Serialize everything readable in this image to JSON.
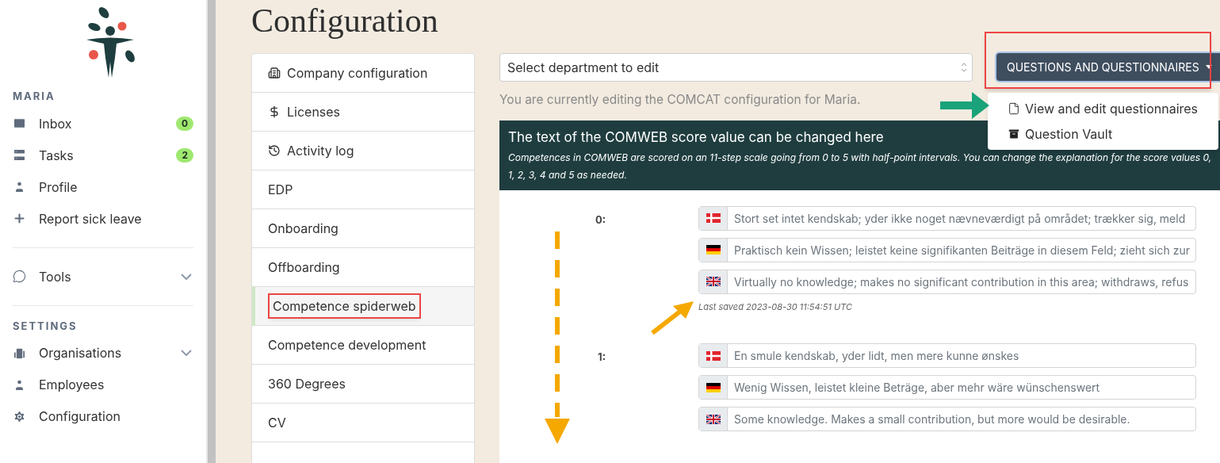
{
  "sidebar": {
    "sections": [
      {
        "heading": "MARIA",
        "items": [
          {
            "label": "Inbox",
            "badge": "0"
          },
          {
            "label": "Tasks",
            "badge": "2"
          },
          {
            "label": "Profile"
          },
          {
            "label": "Report sick leave"
          }
        ]
      },
      {
        "items": [
          {
            "label": "Tools",
            "expandable": true
          }
        ]
      },
      {
        "heading": "SETTINGS",
        "items": [
          {
            "label": "Organisations",
            "expandable": true
          },
          {
            "label": "Employees"
          },
          {
            "label": "Configuration"
          }
        ]
      }
    ]
  },
  "page_title": "Configuration",
  "config_menu": [
    {
      "label": "Company configuration",
      "selected": false
    },
    {
      "label": "Licenses",
      "selected": false
    },
    {
      "label": "Activity log",
      "selected": false
    },
    {
      "label": "EDP",
      "selected": false
    },
    {
      "label": "Onboarding",
      "selected": false
    },
    {
      "label": "Offboarding",
      "selected": false
    },
    {
      "label": "Competence spiderweb",
      "selected": true
    },
    {
      "label": "Competence development",
      "selected": false
    },
    {
      "label": "360 Degrees",
      "selected": false
    },
    {
      "label": "CV",
      "selected": false
    }
  ],
  "department_select": {
    "placeholder": "Select department to edit"
  },
  "editing_note": "You are currently editing the COMCAT configuration for Maria.",
  "questions_button": {
    "label": "QUESTIONS AND QUESTIONNAIRES",
    "expanded": true,
    "menu": [
      {
        "label": "View and edit questionnaires"
      },
      {
        "label": "Question Vault"
      }
    ]
  },
  "score_panel": {
    "title": "The text of the COMWEB score value can be changed here",
    "description": "Competences in COMWEB are scored on an 11-step scale going from 0 to 5 with half-point intervals. You can change the explanation for the score values 0, 1, 2, 3, 4 and 5 as needed.",
    "scores": [
      {
        "label": "0:",
        "texts": [
          {
            "kind": "danish",
            "value": "Stort set intet kendskab; yder ikke noget nævneværdigt på området; trækker sig, meld"
          },
          {
            "kind": "german",
            "value": "Praktisch kein Wissen; leistet keine signifikanten Beiträge in diesem Feld; zieht sich zur"
          },
          {
            "kind": "english",
            "value": "Virtually no knowledge; makes no significant contribution in this area; withdraws, refus"
          }
        ],
        "last_saved": "Last saved 2023-08-30 11:54:51 UTC"
      },
      {
        "label": "1:",
        "texts": [
          {
            "kind": "danish",
            "value": "En smule kendskab, yder lidt, men mere kunne ønskes"
          },
          {
            "kind": "german",
            "value": "Wenig Wissen, leistet kleine Beträge, aber mehr wäre wünschenswert"
          },
          {
            "kind": "english",
            "value": "Some knowledge. Makes a small contribution, but more would be desirable."
          }
        ]
      }
    ]
  }
}
